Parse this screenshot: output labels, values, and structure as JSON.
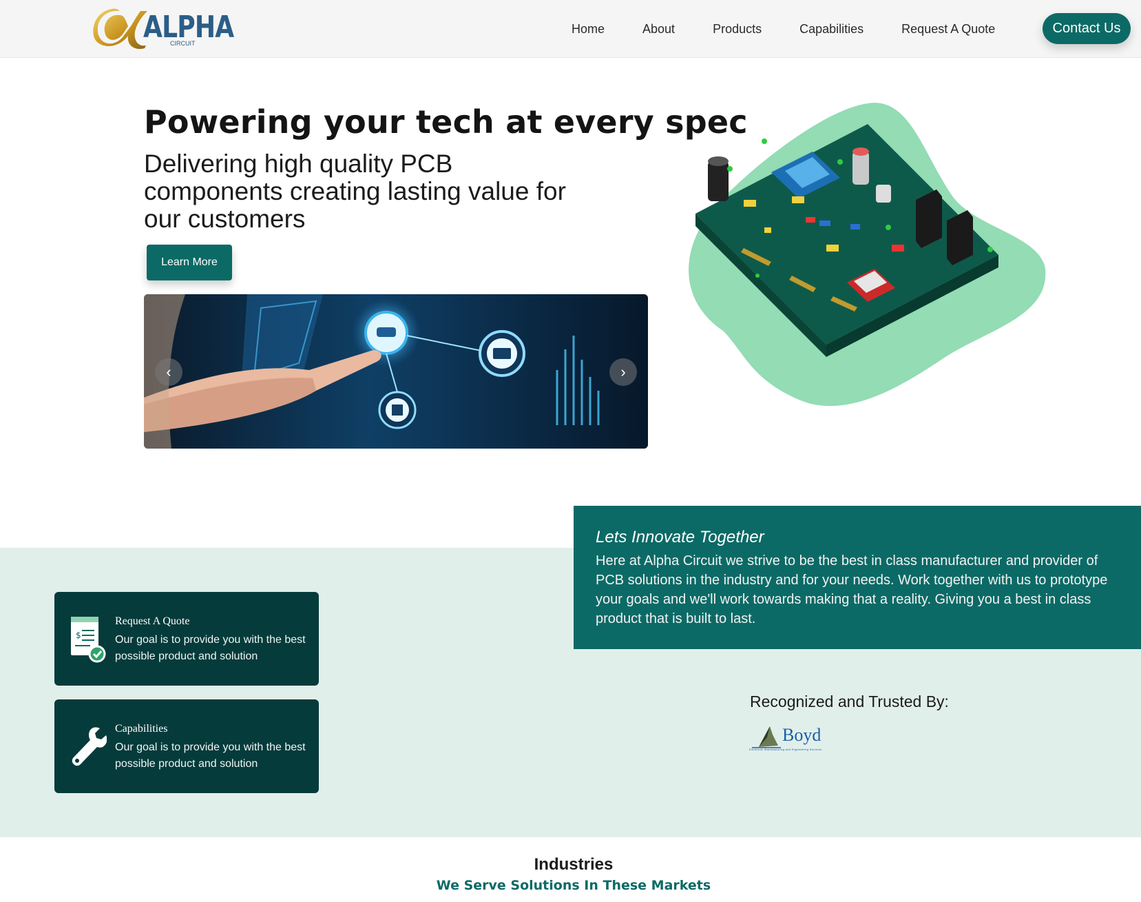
{
  "colors": {
    "accent": "#0c6a66",
    "card_bg": "#063b3b",
    "mint_bg": "#e1efea",
    "logo_blue": "#2b5e87",
    "logo_gold": "#d9b23b"
  },
  "brand": {
    "name": "ALPHA",
    "sub": "CIRCUIT",
    "icon": "alpha-logo-icon"
  },
  "nav": {
    "items": [
      {
        "label": "Home"
      },
      {
        "label": "About"
      },
      {
        "label": "Products"
      },
      {
        "label": "Capabilities"
      },
      {
        "label": "Request A Quote"
      }
    ],
    "cta": "Contact Us"
  },
  "hero": {
    "title": "Powering your tech at every spec",
    "subtitle": "Delivering high quality PCB components creating lasting value for our customers",
    "button": "Learn More",
    "carousel": {
      "prev_icon": "chevron-left-icon",
      "next_icon": "chevron-right-icon",
      "prev": "‹",
      "next": "›"
    }
  },
  "innovate": {
    "title": "Lets Innovate Together",
    "text": "Here at Alpha Circuit we strive to be the best in class manufacturer and provider of PCB solutions in the industry and for your needs. Work together with us to prototype your goals and we'll work towards making that a reality. Giving you a best in class product that is built to last."
  },
  "cards": [
    {
      "title": "Request A Quote",
      "text": "Our goal is to provide you with the best possible product and solution",
      "icon": "quote-document-icon"
    },
    {
      "title": "Capabilities",
      "text": "Our goal is to provide you with the best possible product and solution",
      "icon": "wrench-icon"
    }
  ],
  "trusted": {
    "title": "Recognized and Trusted By:",
    "partner": "Boyd",
    "partner_tag": "Electronic Manufacturing and Engineering Services"
  },
  "industries": {
    "title": "Industries",
    "subtitle": "We Serve Solutions In These Markets"
  }
}
